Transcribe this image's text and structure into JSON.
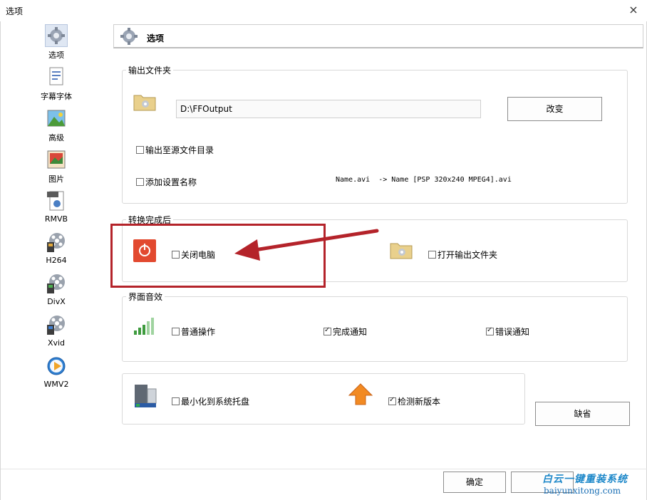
{
  "window": {
    "title": "选项",
    "close_icon": "×"
  },
  "sidebar": {
    "items": [
      {
        "label": "选项",
        "icon": "gear-options-icon",
        "active": true
      },
      {
        "label": "字幕字体",
        "icon": "subtitle-font-icon"
      },
      {
        "label": "高级",
        "icon": "advanced-landscape-icon"
      },
      {
        "label": "图片",
        "icon": "picture-icon"
      },
      {
        "label": "RMVB",
        "icon": "rmvb-file-icon"
      },
      {
        "label": "H264",
        "icon": "h264-film-reel-icon"
      },
      {
        "label": "DivX",
        "icon": "divx-film-reel-icon"
      },
      {
        "label": "Xvid",
        "icon": "xvid-film-reel-icon"
      },
      {
        "label": "WMV2",
        "icon": "wmv2-media-icon"
      }
    ]
  },
  "header": {
    "title": "选项"
  },
  "output_folder": {
    "title": "输出文件夹",
    "path": "D:\\FFOutput",
    "change_button": "改变",
    "output_to_source": "输出至源文件目录",
    "add_setting_name": "添加设置名称",
    "name_example": "Name.avi  -> Name [PSP 320x240 MPEG4].avi"
  },
  "after_conversion": {
    "title": "转换完成后",
    "shutdown": "关闭电脑",
    "open_output_folder": "打开输出文件夹"
  },
  "sound": {
    "title": "界面音效",
    "normal_operation": "普通操作",
    "normal_checked": false,
    "complete_notify": "完成通知",
    "complete_checked": true,
    "error_notify": "错误通知",
    "error_checked": true
  },
  "misc": {
    "minimize_to_tray": "最小化到系统托盘",
    "minimize_checked": false,
    "check_update": "检测新版本",
    "update_checked": true,
    "default_button": "缺省"
  },
  "footer": {
    "ok_button": "确定"
  },
  "watermark": {
    "line1": "白云一键重装系统",
    "line2": "baiyunxitong.com"
  },
  "colors": {
    "highlight": "#b4232a",
    "arrow": "#b4232a",
    "power_icon": "#e2492f"
  }
}
